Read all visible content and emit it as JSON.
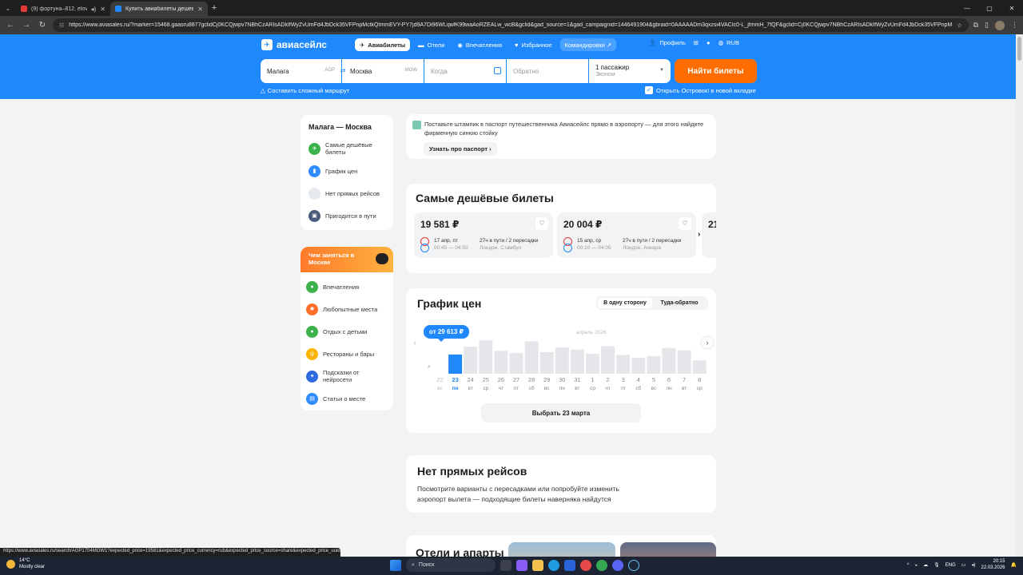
{
  "browser": {
    "tabs": [
      {
        "title": "(9) фортуна–812, elovfes",
        "active": false
      },
      {
        "title": "Купить авиабилеты дешево о",
        "active": true
      }
    ],
    "url": "https://www.aviasales.ru/?marker=15468.gaasru8877gclidCj0KCQjwpv7NBhCzARIsADkIfWyZvUmFd4JbDck35VFPnpMctkQtmmEVY-PY7jd9A7Di96WLqwfK99waAoRZEALw_wcB&gclid&gad_source=1&gad_campaignid=1446491904&gbraid=0AAAAADm3qxzsi4VACIc0-L_jfmmH_7fQF&gclid=Cj0KCQjwpv7NBhCzARIsADkIfWyZvUmFd4JbDck35VFPnpMctkQt...",
    "status_url": "https://www.aviasales.ru/search/AGP1704MOW1?expected_price=19581&expected_price_currency=rub&expected_price_source=share&expected_price_uuid..."
  },
  "header": {
    "logo": "авиасейлс",
    "nav": [
      {
        "label": "Авиабилеты",
        "icon": "plane-icon",
        "active": true
      },
      {
        "label": "Отели",
        "icon": "bed-icon",
        "active": false
      },
      {
        "label": "Впечатления",
        "icon": "pin-icon",
        "active": false
      },
      {
        "label": "Избранное",
        "icon": "heart-icon",
        "active": false
      },
      {
        "label": "Командировки ↗",
        "icon": "",
        "active": false
      }
    ],
    "profile": "Профиль",
    "currency": "RUB"
  },
  "search": {
    "origin": "Малага",
    "origin_code": "AGP",
    "destination": "Москва",
    "destination_code": "MOW",
    "date_placeholder": "Когда",
    "return_placeholder": "Обратно",
    "passengers": "1 пассажир",
    "cabin": "Эконом",
    "submit": "Найти билеты",
    "complex_route": "Составить сложный маршрут",
    "ostrovok": "Открыть Островок! в новой вкладке"
  },
  "sidebar": {
    "route": "Малага — Москва",
    "items": [
      {
        "label": "Самые дешёвые билеты",
        "color": "#3bb34a",
        "icon": "plane-icon"
      },
      {
        "label": "График цен",
        "color": "#2f8cff",
        "icon": "chart-icon"
      },
      {
        "label": "Нет прямых рейсов",
        "color": "#d9dde3",
        "icon": "route-icon"
      },
      {
        "label": "Пригодится в пути",
        "color": "#4a5a7a",
        "icon": "bag-icon"
      }
    ],
    "moscow_title": "Чем заняться в Москве",
    "moscow_items": [
      {
        "label": "Впечатления",
        "color": "#3bb34a",
        "icon": "pin-icon"
      },
      {
        "label": "Любопытные места",
        "color": "#ff6d2a",
        "icon": "fire-icon"
      },
      {
        "label": "Отдых с детьми",
        "color": "#3bb34a",
        "icon": "pin-icon"
      },
      {
        "label": "Рестораны и бары",
        "color": "#ffb300",
        "icon": "fork-icon"
      },
      {
        "label": "Подсказки от нейросети",
        "color": "#2f6be0",
        "icon": "sparkle-icon"
      },
      {
        "label": "Статьи о месте",
        "color": "#2f8cff",
        "icon": "news-icon"
      }
    ]
  },
  "banner": {
    "text": "Поставьте штампик в паспорт путешественника Авиасейлс прямо в аэропорту — для этого найдите фирменную синюю стойку",
    "button": "Узнать про паспорт ›"
  },
  "cheapest": {
    "title": "Самые дешёвые билеты",
    "tickets": [
      {
        "price": "19 581 ₽",
        "date": "17 апр, пт",
        "times": "00:45 — 04:50",
        "duration": "27ч в пути / 2 пересадки",
        "via": "Лондон, Стамбул"
      },
      {
        "price": "20 004 ₽",
        "date": "15 апр, ср",
        "times": "00:10 — 04:05",
        "duration": "27ч в пути / 2 пересадки",
        "via": "Лондон, Анкара"
      }
    ],
    "partial_price": "21"
  },
  "graph": {
    "title": "График цен",
    "toggle": [
      "В одну сторону",
      "Туда-обратно"
    ],
    "price_tag": "от 29 613 ₽",
    "month_label": "апрель 2026",
    "select_button": "Выбрать 23 марта"
  },
  "chart_data": {
    "type": "bar",
    "categories": [
      "22",
      "23",
      "24",
      "25",
      "26",
      "27",
      "28",
      "29",
      "30",
      "31",
      "1",
      "2",
      "3",
      "4",
      "5",
      "6",
      "7",
      "8"
    ],
    "weekdays": [
      "вс",
      "пн",
      "вт",
      "ср",
      "чт",
      "пт",
      "сб",
      "вс",
      "пн",
      "вт",
      "ср",
      "чт",
      "пт",
      "сб",
      "вс",
      "пн",
      "вт",
      "ср"
    ],
    "values": [
      null,
      29613,
      31500,
      33000,
      30500,
      30000,
      32800,
      30200,
      31300,
      30800,
      29800,
      31600,
      29500,
      28800,
      29200,
      31200,
      30600,
      28200
    ],
    "selected_index": 1,
    "highlight_color": "#1e88fc",
    "bar_color": "#e4e6ea"
  },
  "nodirect": {
    "title": "Нет прямых рейсов",
    "text": "Посмотрите варианты с пересадками или попробуйте изменить аэропорт вылета — подходящие билеты наверняка найдутся"
  },
  "hotels": {
    "title": "Отели и апарты"
  },
  "taskbar": {
    "weather_temp": "14°C",
    "weather_text": "Mostly clear",
    "search": "Поиск",
    "lang": "ENG",
    "time": "20:15",
    "date": "22.03.2026"
  }
}
